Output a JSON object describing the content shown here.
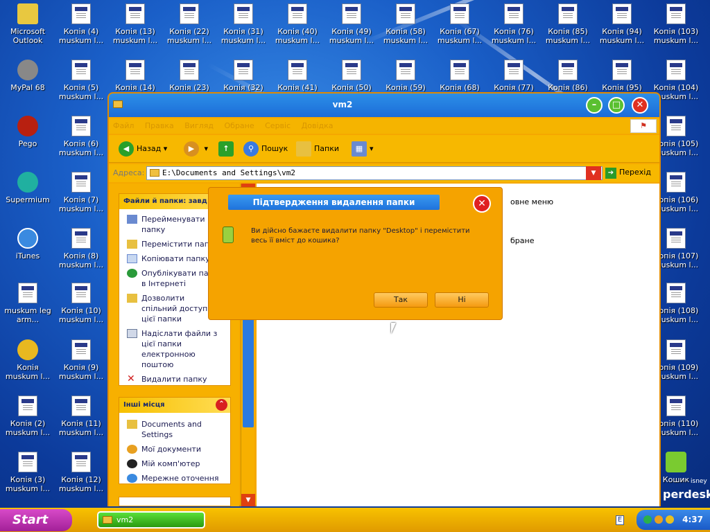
{
  "desktop": {
    "icons": [
      {
        "label": "Microsoft\nOutlook"
      },
      {
        "label": "MyPal 68"
      },
      {
        "label": "Pego"
      },
      {
        "label": "Supermium"
      },
      {
        "label": "iTunes"
      },
      {
        "label": "muskum leg\narm..."
      },
      {
        "label": "Копія\nmuskum l..."
      },
      {
        "label": "Копія (2)\nmuskum l..."
      },
      {
        "label": "Копія (3)\nmuskum l..."
      },
      {
        "label": "Копія (4)\nmuskum l..."
      },
      {
        "label": "Копія (5)\nmuskum l..."
      },
      {
        "label": "Копія (6)\nmuskum l..."
      },
      {
        "label": "Копія (7)\nmuskum l..."
      },
      {
        "label": "Копія (8)\nmuskum l..."
      },
      {
        "label": "Копія (10)\nmuskum l..."
      },
      {
        "label": "Копія (9)\nmuskum l..."
      },
      {
        "label": "Копія (11)\nmuskum l..."
      },
      {
        "label": "Копія (12)\nmuskum l..."
      },
      {
        "label": "Копія (13)\nmuskum l..."
      },
      {
        "label": "Копія (14)"
      },
      {
        "label": "Копія (22)\nmuskum l..."
      },
      {
        "label": "Копія (23)"
      },
      {
        "label": "Копія (31)\nmuskum l..."
      },
      {
        "label": "Копія (32)"
      },
      {
        "label": "Копія (40)\nmuskum l..."
      },
      {
        "label": "Копія (41)"
      },
      {
        "label": "Копія (49)\nmuskum l..."
      },
      {
        "label": "Копія (50)"
      },
      {
        "label": "Копія (58)\nmuskum l..."
      },
      {
        "label": "Копія (59)"
      },
      {
        "label": "Копія (67)\nmuskum l..."
      },
      {
        "label": "Копія (68)"
      },
      {
        "label": "Копія (76)\nmuskum l..."
      },
      {
        "label": "Копія (77)"
      },
      {
        "label": "Копія (85)\nmuskum l..."
      },
      {
        "label": "Копія (86)"
      },
      {
        "label": "Копія (94)\nmuskum l..."
      },
      {
        "label": "Копія (95)"
      },
      {
        "label": "Копія (103)\nmuskum l..."
      },
      {
        "label": "Копія (104)\nmuskum l..."
      },
      {
        "label": "Копія (105)\nmuskum l..."
      },
      {
        "label": "Копія (106)\nmuskum l..."
      },
      {
        "label": "Копія (107)\nmuskum l..."
      },
      {
        "label": "Копія (108)\nmuskum l..."
      },
      {
        "label": "Копія (109)\nmuskum l..."
      },
      {
        "label": "Копія (110)\nmuskum l..."
      },
      {
        "label": "Кошик"
      }
    ],
    "brand_text": "perdesk",
    "brand_small": "isney"
  },
  "window": {
    "title": "vm2",
    "menu": [
      "Файл",
      "Правка",
      "Вигляд",
      "Обране",
      "Сервіс",
      "Довідка"
    ],
    "toolbar": {
      "back": "Назад",
      "search": "Пошук",
      "folders": "Папки"
    },
    "address": {
      "label": "Адреса:",
      "value": "E:\\Documents and Settings\\vm2",
      "go": "Перехід"
    },
    "tasks_panel": {
      "header": "Файли й папки: завд",
      "items": [
        "Перейменувати\nпапку",
        "Перемістити папку",
        "Копіювати папку",
        "Опублікувати папку\nв Інтернеті",
        "Дозволити\nспільний доступ\nцієї папки",
        "Надіслати файли з\nцієї папки\nелектронною\nпоштою",
        "Видалити папку"
      ]
    },
    "places_panel": {
      "header": "Інші місця",
      "items": [
        "Documents and\nSettings",
        "Мої документи",
        "Мій комп'ютер",
        "Мережне оточення"
      ]
    },
    "main": {
      "text1": "овне меню",
      "text2": "бране"
    }
  },
  "dialog": {
    "title": "Підтвердження видалення папки",
    "message": "Ви дійсно бажаєте видалити папку \"Desktop\" і перемістити весь її вміст до кошика?",
    "yes": "Так",
    "no": "Ні"
  },
  "taskbar": {
    "start": "Start",
    "task": "vm2",
    "lang": "E",
    "clock": "4:37"
  }
}
